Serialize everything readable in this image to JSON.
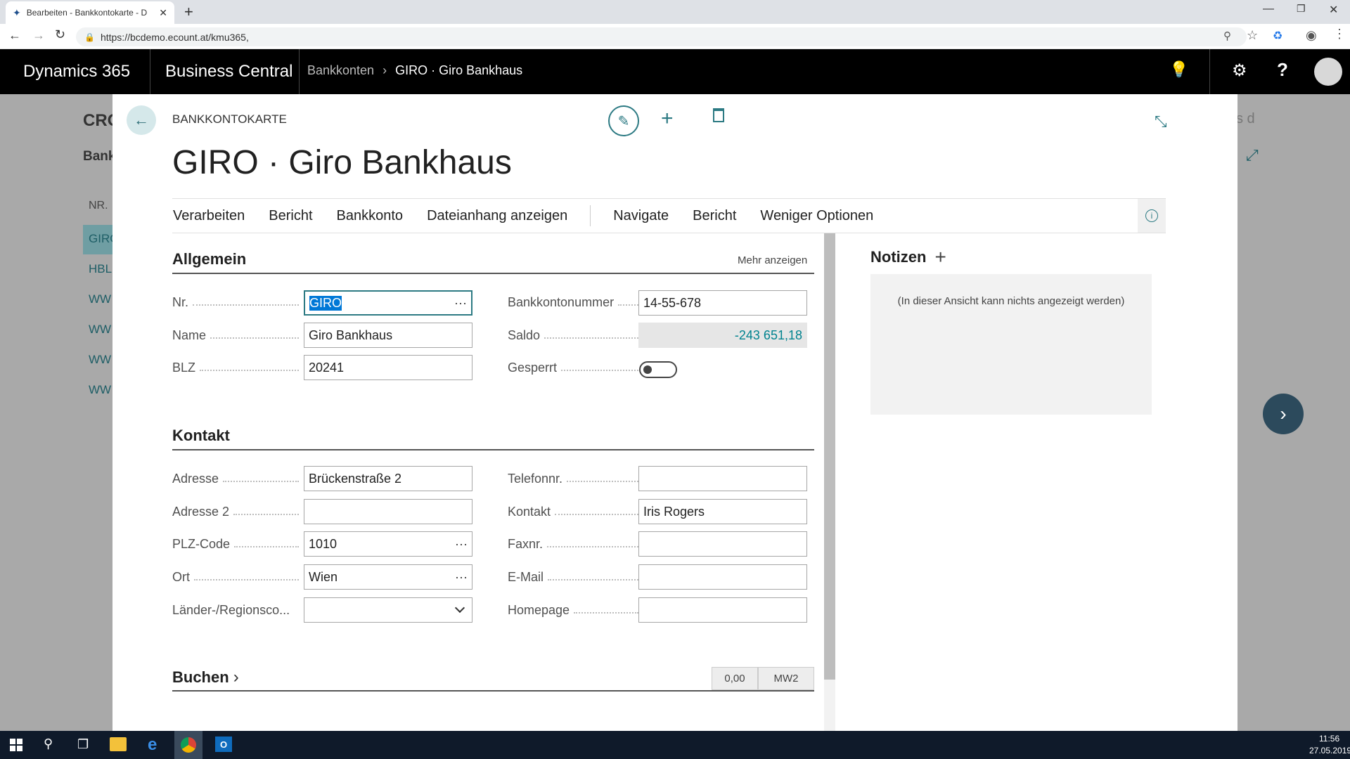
{
  "browser": {
    "tab_title": "Bearbeiten - Bankkontokarte - D",
    "url": "https://bcdemo.ecount.at/kmu365,"
  },
  "app": {
    "product": "Dynamics 365",
    "module": "Business Central",
    "breadcrumb_parent": "Bankkonten",
    "breadcrumb_current": "GIRO · Giro Bankhaus"
  },
  "background": {
    "title_partial": "CRO",
    "sub_partial": "Bank",
    "col_header": "NR.",
    "rows": [
      "GIRO",
      "HBL",
      "WW",
      "WW",
      "WW",
      "WW"
    ],
    "right_partial": "s d"
  },
  "card": {
    "caption": "BANKKONTOKARTE",
    "title": "GIRO · Giro Bankhaus",
    "actions": [
      "Verarbeiten",
      "Bericht",
      "Bankkonto",
      "Dateianhang anzeigen",
      "Navigate",
      "Bericht",
      "Weniger Optionen"
    ],
    "general": {
      "header": "Allgemein",
      "more": "Mehr anzeigen",
      "nr_label": "Nr.",
      "nr_value": "GIRO",
      "name_label": "Name",
      "name_value": "Giro Bankhaus",
      "blz_label": "BLZ",
      "blz_value": "20241",
      "konto_label": "Bankkontonummer",
      "konto_value": "14-55-678",
      "saldo_label": "Saldo",
      "saldo_value": "-243 651,18",
      "gesperrt_label": "Gesperrt"
    },
    "contact": {
      "header": "Kontakt",
      "adresse_label": "Adresse",
      "adresse_value": "Brückenstraße 2",
      "adresse2_label": "Adresse 2",
      "adresse2_value": "",
      "plz_label": "PLZ-Code",
      "plz_value": "1010",
      "ort_label": "Ort",
      "ort_value": "Wien",
      "land_label": "Länder-/Regionsco...",
      "land_value": "",
      "tel_label": "Telefonnr.",
      "tel_value": "",
      "kontakt_label": "Kontakt",
      "kontakt_value": "Iris Rogers",
      "fax_label": "Faxnr.",
      "fax_value": "",
      "email_label": "E-Mail",
      "email_value": "",
      "homepage_label": "Homepage",
      "homepage_value": ""
    },
    "posting": {
      "header": "Buchen",
      "amount": "0,00",
      "code": "MW2"
    },
    "notes": {
      "header": "Notizen",
      "empty": "(In dieser Ansicht kann nichts angezeigt werden)"
    }
  },
  "taskbar": {
    "time": "11:56",
    "date": "27.05.2019"
  },
  "colors": {
    "accent": "#00838f",
    "saldo": "#00838f",
    "selection": "#0078d7"
  }
}
